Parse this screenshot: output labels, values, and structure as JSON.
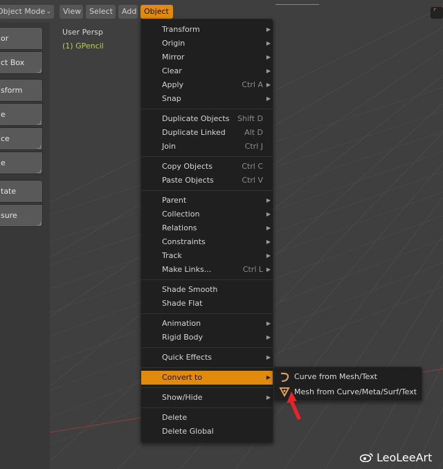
{
  "header": {
    "mode_dropdown": "Object Mode",
    "menus": [
      "View",
      "Select",
      "Add",
      "Object"
    ],
    "active_menu": "Object"
  },
  "viewport": {
    "view_label": "User Persp",
    "object_label": "(1) GPencil"
  },
  "toolbar": {
    "items": [
      "or",
      "ct Box",
      "sform",
      "e",
      "ce",
      "e",
      "tate",
      "sure"
    ]
  },
  "object_menu": {
    "groups": [
      [
        {
          "label": "Transform",
          "shortcut": "",
          "submenu": true
        },
        {
          "label": "Origin",
          "shortcut": "",
          "submenu": true
        },
        {
          "label": "Mirror",
          "shortcut": "",
          "submenu": true
        },
        {
          "label": "Clear",
          "shortcut": "",
          "submenu": true
        },
        {
          "label": "Apply",
          "shortcut": "Ctrl A",
          "submenu": true
        },
        {
          "label": "Snap",
          "shortcut": "",
          "submenu": true
        }
      ],
      [
        {
          "label": "Duplicate Objects",
          "shortcut": "Shift D",
          "submenu": false
        },
        {
          "label": "Duplicate Linked",
          "shortcut": "Alt D",
          "submenu": false
        },
        {
          "label": "Join",
          "shortcut": "Ctrl J",
          "submenu": false
        }
      ],
      [
        {
          "label": "Copy Objects",
          "shortcut": "Ctrl C",
          "submenu": false
        },
        {
          "label": "Paste Objects",
          "shortcut": "Ctrl V",
          "submenu": false
        }
      ],
      [
        {
          "label": "Parent",
          "shortcut": "",
          "submenu": true
        },
        {
          "label": "Collection",
          "shortcut": "",
          "submenu": true
        },
        {
          "label": "Relations",
          "shortcut": "",
          "submenu": true
        },
        {
          "label": "Constraints",
          "shortcut": "",
          "submenu": true
        },
        {
          "label": "Track",
          "shortcut": "",
          "submenu": true
        },
        {
          "label": "Make Links...",
          "shortcut": "Ctrl L",
          "submenu": true
        }
      ],
      [
        {
          "label": "Shade Smooth",
          "shortcut": "",
          "submenu": false
        },
        {
          "label": "Shade Flat",
          "shortcut": "",
          "submenu": false
        }
      ],
      [
        {
          "label": "Animation",
          "shortcut": "",
          "submenu": true
        },
        {
          "label": "Rigid Body",
          "shortcut": "",
          "submenu": true
        }
      ],
      [
        {
          "label": "Quick Effects",
          "shortcut": "",
          "submenu": true
        }
      ],
      [
        {
          "label": "Convert to",
          "shortcut": "",
          "submenu": true,
          "highlighted": true
        }
      ],
      [
        {
          "label": "Show/Hide",
          "shortcut": "",
          "submenu": true
        }
      ],
      [
        {
          "label": "Delete",
          "shortcut": "",
          "submenu": false
        },
        {
          "label": "Delete Global",
          "shortcut": "",
          "submenu": false
        }
      ]
    ]
  },
  "convert_menu": {
    "items": [
      {
        "label": "Curve from Mesh/Text",
        "icon": "curve-icon"
      },
      {
        "label": "Mesh from Curve/Meta/Surf/Text",
        "icon": "mesh-icon"
      }
    ]
  },
  "watermark": {
    "text": "LeoLeeArt"
  },
  "colors": {
    "accent": "#e18a0b",
    "menu_bg": "#1f1f1f",
    "object_label": "#b4d15a",
    "annotation_arrow": "#e8232a"
  }
}
